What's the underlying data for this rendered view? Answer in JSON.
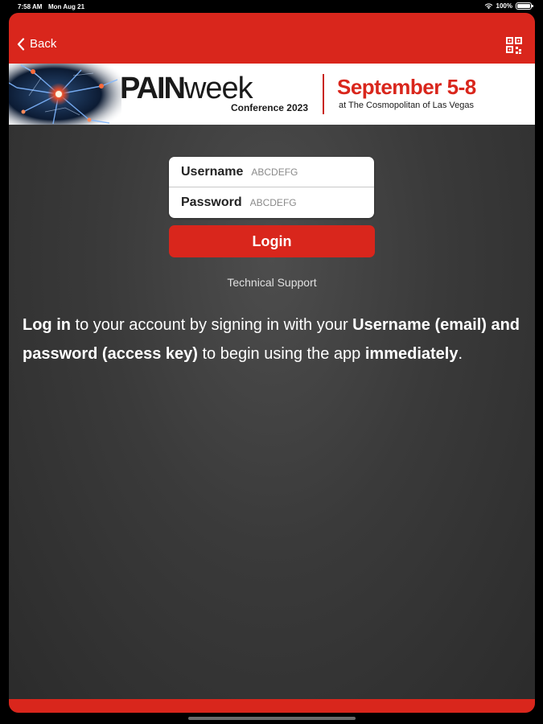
{
  "status_bar": {
    "time": "7:58 AM",
    "date": "Mon Aug 21",
    "battery": "100%"
  },
  "nav": {
    "back_label": "Back",
    "qr_icon": "qr-code-icon"
  },
  "banner": {
    "brand_bold": "PAIN",
    "brand_light": "week",
    "brand_subtitle": "Conference 2023",
    "event_dates": "September 5-8",
    "event_venue": "at The Cosmopolitan of Las Vegas"
  },
  "login_form": {
    "username_label": "Username",
    "username_placeholder": "ABCDEFG",
    "password_label": "Password",
    "password_placeholder": "ABCDEFG",
    "login_button": "Login",
    "support_link": "Technical Support"
  },
  "intro": {
    "p1_bold": "Log in",
    "p2": " to your account by signing in with your ",
    "p3_bold": "Username (email) and password (access key)",
    "p4": " to begin using the app ",
    "p5_bold": "immediately",
    "p6": "."
  },
  "colors": {
    "brand_red": "#d9261c",
    "background": "#3a3a3a"
  }
}
